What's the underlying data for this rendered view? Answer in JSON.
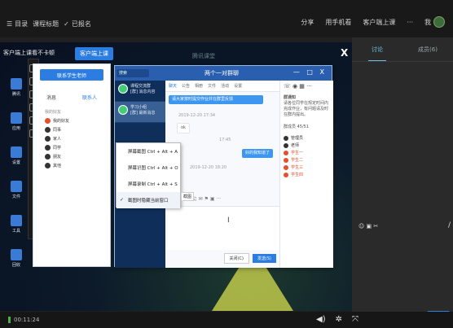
{
  "topbar": {
    "menu_label": "目录",
    "course_title": "课程标题",
    "signup_label": "已报名",
    "right_items": [
      "分享",
      "用手机看",
      "客户端上课"
    ],
    "more_label": "···",
    "user_label": "我",
    "avatar_color": "#3d6b3a"
  },
  "stage": {
    "title": "客户端上课看不卡顿",
    "cta_label": "客户端上课",
    "watermark": "腾讯课堂",
    "close_label": "X",
    "desktop_icons": [
      "腾讯",
      "应用",
      "设置",
      "文件",
      "工具",
      "回收"
    ]
  },
  "contacts": {
    "top_button": "联系学生老师",
    "tabs": [
      "消息",
      "联系人"
    ],
    "active_tab": "联系人",
    "section_label": "我的好友",
    "rows": [
      {
        "name": "我的好友",
        "color": "#e4502b"
      },
      {
        "name": "同事",
        "color": "#333333"
      },
      {
        "name": "家人",
        "color": "#333333"
      },
      {
        "name": "同学",
        "color": "#333333"
      },
      {
        "name": "朋友",
        "color": "#333333"
      },
      {
        "name": "其他",
        "color": "#333333"
      }
    ]
  },
  "chat": {
    "search_placeholder": "搜索",
    "window_title": "两个一对群聊",
    "window_controls": "— □ X",
    "conversations": [
      {
        "name": "课程交流群",
        "sub": "[群] 消息内容"
      },
      {
        "name": "学习小组",
        "sub": "[群] 最新消息"
      }
    ],
    "tabs": [
      "聊天",
      "公告",
      "相册",
      "文件",
      "活动",
      "设置"
    ],
    "active_tab": "聊天",
    "messages": [
      {
        "type": "sent",
        "text": "请大家按时提交作业并在群里反馈"
      },
      {
        "type": "time",
        "text": "2019-12-20 17:34"
      },
      {
        "type": "recv",
        "text": "ok"
      },
      {
        "type": "time",
        "text": "17:45"
      },
      {
        "type": "sent",
        "text": "好的我知道了"
      },
      {
        "type": "time",
        "text": "2019-12-20 18:20"
      }
    ],
    "input_tools": "☺ ✂ ⎘ ▭ ♫ ✉ ⚑ ▣ ···",
    "cursor": "I",
    "close_btn": "关闭(C)",
    "send_btn": "发送(S)",
    "side_icons": "☏ ◉ ▦ ···",
    "side_notice_title": "群通知",
    "side_notice": "请各位同学在规定时间内完成作业，有问题请及时在群内提出。",
    "member_count_label": "群成员 45/51",
    "members": [
      {
        "name": "管理员",
        "red": false
      },
      {
        "name": "老师",
        "red": false
      },
      {
        "name": "学生一",
        "red": true
      },
      {
        "name": "学生二",
        "red": true
      },
      {
        "name": "学生三",
        "red": true
      },
      {
        "name": "学生四",
        "red": true
      }
    ]
  },
  "context_menu": {
    "items": [
      {
        "label": "屏幕截图 Ctrl + Alt + A",
        "checked": false
      },
      {
        "label": "屏幕识图 Ctrl + Alt + O",
        "checked": false
      },
      {
        "label": "屏幕录制 Ctrl + Alt + S",
        "checked": false
      },
      {
        "label": "截图时隐藏当前窗口",
        "checked": true
      }
    ],
    "tooltip": "截图"
  },
  "right_panel": {
    "tabs": [
      "讨论",
      "成员(6)"
    ],
    "active_tab": "讨论",
    "tool_icons": "☺ ▣ ✂",
    "send_label": "发送"
  },
  "bottombar": {
    "time": "00:11:24",
    "controls": [
      "volume",
      "settings",
      "fullscreen"
    ]
  }
}
